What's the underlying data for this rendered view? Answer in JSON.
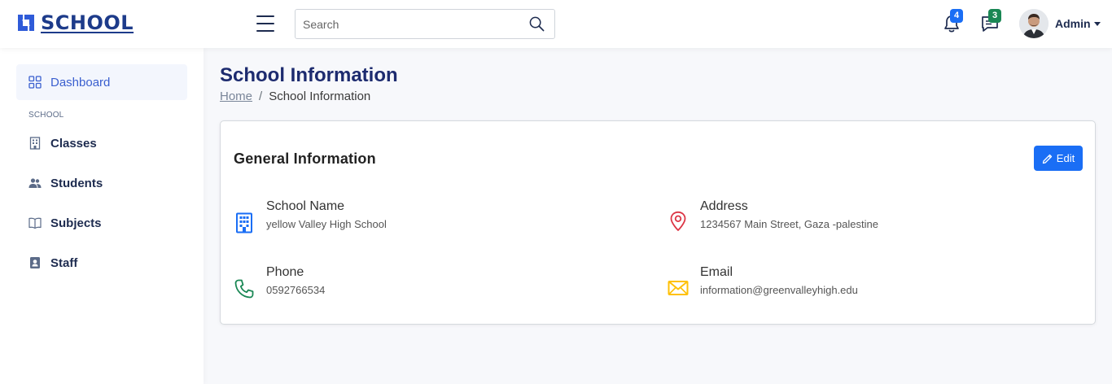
{
  "app": {
    "logo_text": "SCHOOL"
  },
  "header": {
    "search": {
      "placeholder": "Search",
      "value": ""
    },
    "notifications_count": "4",
    "messages_count": "3",
    "user_name": "Admin"
  },
  "sidebar": {
    "dashboard": "Dashboard",
    "section_label": "SCHOOL",
    "items": [
      {
        "label": "Classes",
        "icon": "building-icon"
      },
      {
        "label": "Students",
        "icon": "people-icon"
      },
      {
        "label": "Subjects",
        "icon": "book-icon"
      },
      {
        "label": "Staff",
        "icon": "badge-icon"
      }
    ]
  },
  "page": {
    "title": "School Information",
    "breadcrumb": {
      "home": "Home",
      "separator": "/",
      "current": "School Information"
    }
  },
  "card": {
    "title": "General Information",
    "edit_label": "Edit",
    "fields": {
      "school_name": {
        "label": "School Name",
        "value": "yellow Valley High School",
        "icon": "building-icon",
        "color": "#1a6ef5"
      },
      "address": {
        "label": "Address",
        "value": "1234567 Main Street, Gaza -palestine",
        "icon": "location-pin-icon",
        "color": "#dc3545"
      },
      "phone": {
        "label": "Phone",
        "value": "0592766534",
        "icon": "phone-icon",
        "color": "#198754"
      },
      "email": {
        "label": "Email",
        "value": "information@greenvalleyhigh.edu",
        "icon": "envelope-icon",
        "color": "#ffc107"
      }
    }
  },
  "colors": {
    "primary": "#1a6ef5",
    "navy": "#1d2b4f",
    "success": "#198754"
  }
}
